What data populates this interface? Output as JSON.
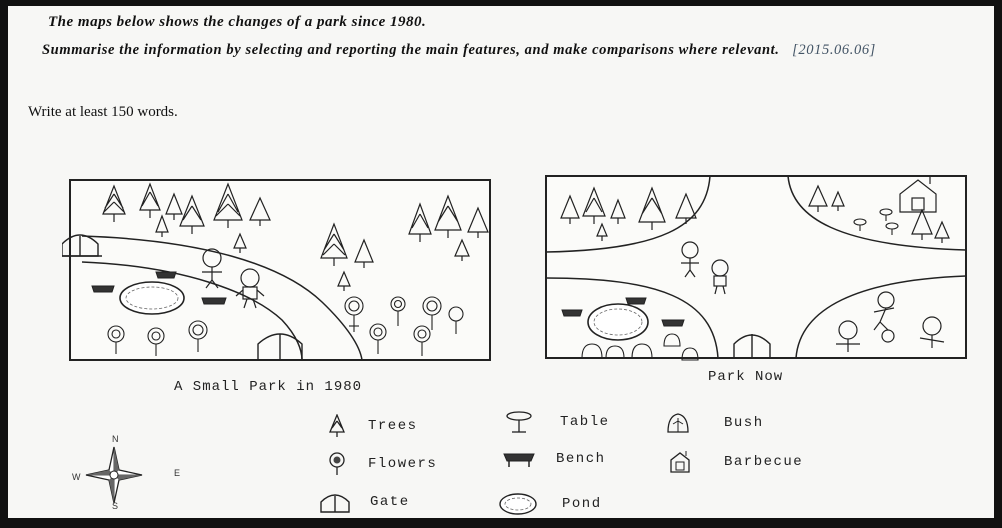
{
  "task": {
    "title": "The maps below shows the changes of a park since 1980.",
    "instruction": "Summarise the information by selecting and reporting the main features, and make comparisons where relevant.",
    "date": "[2015.06.06]",
    "word_count": "Write at least 150 words."
  },
  "maps": {
    "left_caption": "A Small Park in 1980",
    "right_caption": "Park Now"
  },
  "legend": {
    "trees": "Trees",
    "flowers": "Flowers",
    "gate": "Gate",
    "table": "Table",
    "bench": "Bench",
    "pond": "Pond",
    "bush": "Bush",
    "barbecue": "Barbecue"
  },
  "compass": {
    "n": "N",
    "s": "S",
    "e": "E",
    "w": "W"
  }
}
